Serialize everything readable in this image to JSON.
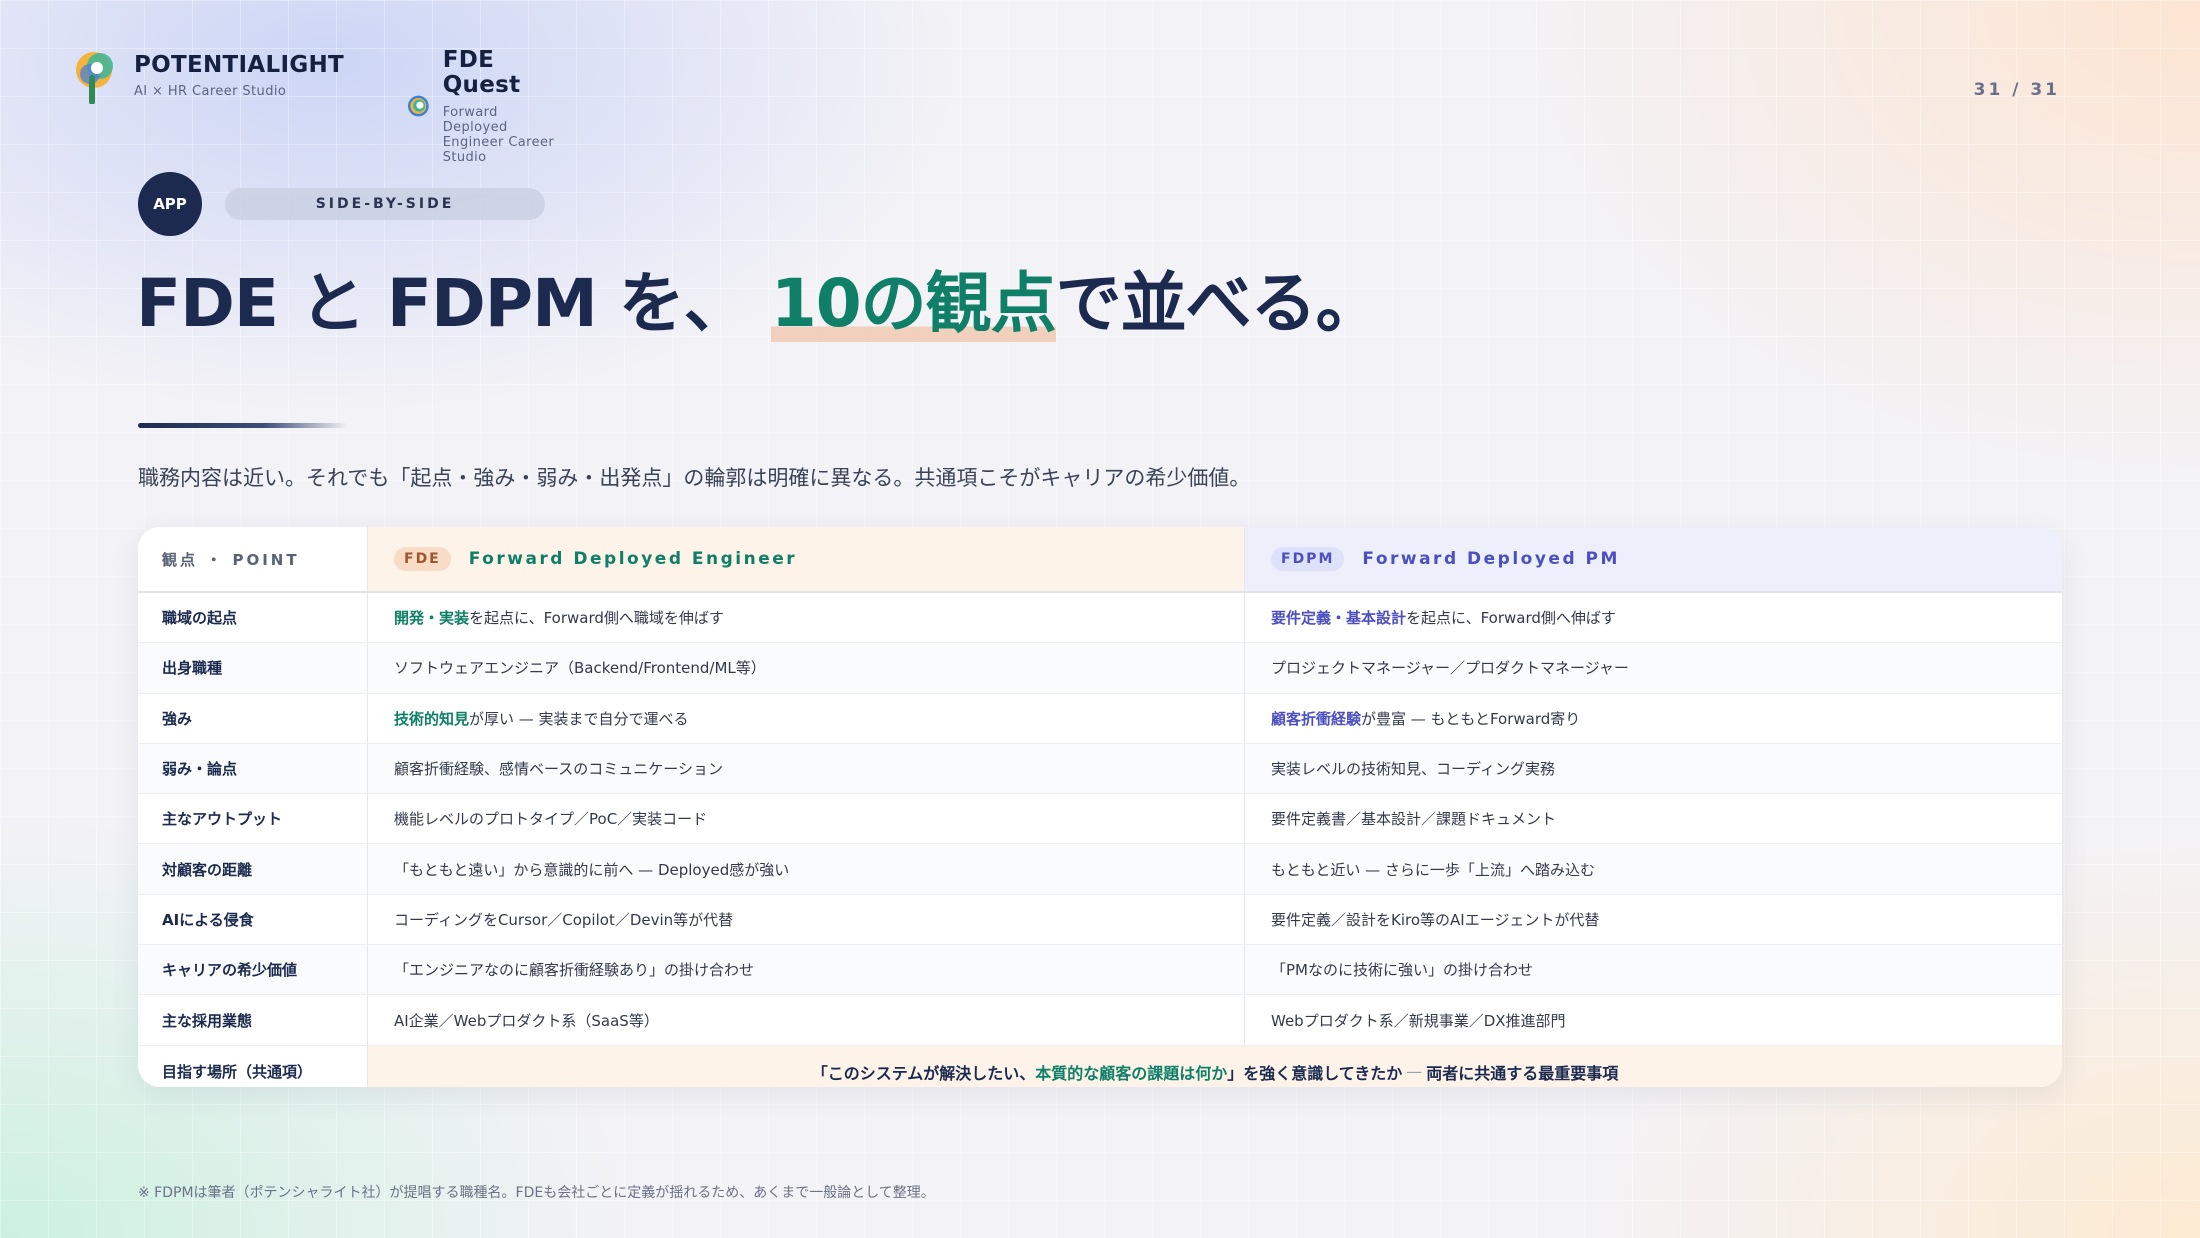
{
  "header": {
    "brand1": {
      "name": "POTENTIALIGHT",
      "tagline": "AI × HR Career Studio"
    },
    "brand2": {
      "name": "FDE Quest",
      "tagline": "Forward Deployed Engineer Career Studio"
    },
    "page_number": "31 / 31"
  },
  "badge": "APP",
  "section_pill": "SIDE-BY-SIDE",
  "title": {
    "part1": "FDE と FDPM を、",
    "highlight": "10の観点",
    "part2": "で並べる。"
  },
  "lead": "職務内容は近い。それでも「起点・強み・弱み・出発点」の輪郭は明確に異なる。共通項こそがキャリアの希少価値。",
  "table": {
    "header_point": "観点 ・ POINT",
    "fde_tag": "FDE",
    "fde_title": "Forward Deployed Engineer",
    "fdpm_tag": "FDPM",
    "fdpm_title": "Forward Deployed PM",
    "rows": [
      {
        "point": "職域の起点",
        "fde_em": "開発・実装",
        "fde": " を起点に、Forward側へ職域を伸ばす",
        "fdpm_em": "要件定義・基本設計",
        "fdpm": " を起点に、Forward側へ伸ばす"
      },
      {
        "point": "出身職種",
        "fde_em": "",
        "fde": "ソフトウェアエンジニア（Backend/Frontend/ML等）",
        "fdpm_em": "",
        "fdpm": "プロジェクトマネージャー／プロダクトマネージャー"
      },
      {
        "point": "強み",
        "fde_em": "技術的知見",
        "fde": "が厚い — 実装まで自分で運べる",
        "fdpm_em": "顧客折衝経験",
        "fdpm": "が豊富 — もともとForward寄り"
      },
      {
        "point": "弱み・論点",
        "fde_em": "",
        "fde": "顧客折衝経験、感情ベースのコミュニケーション",
        "fdpm_em": "",
        "fdpm": "実装レベルの技術知見、コーディング実務"
      },
      {
        "point": "主なアウトプット",
        "fde_em": "",
        "fde": "機能レベルのプロトタイプ／PoC／実装コード",
        "fdpm_em": "",
        "fdpm": "要件定義書／基本設計／課題ドキュメント"
      },
      {
        "point": "対顧客の距離",
        "fde_em": "",
        "fde": "「もともと遠い」から意識的に前へ — Deployed感が強い",
        "fdpm_em": "",
        "fdpm": "もともと近い — さらに一歩「上流」へ踏み込む"
      },
      {
        "point": "AIによる侵食",
        "fde_em": "",
        "fde": "コーディングをCursor／Copilot／Devin等が代替",
        "fdpm_em": "",
        "fdpm": "要件定義／設計をKiro等のAIエージェントが代替"
      },
      {
        "point": "キャリアの希少価値",
        "fde_em": "",
        "fde": "「エンジニアなのに顧客折衝経験あり」の掛け合わせ",
        "fdpm_em": "",
        "fdpm": "「PMなのに技術に強い」の掛け合わせ"
      },
      {
        "point": "主な採用業態",
        "fde_em": "",
        "fde": "AI企業／Webプロダクト系（SaaS等）",
        "fdpm_em": "",
        "fdpm": "Webプロダクト系／新規事業／DX推進部門"
      }
    ],
    "final": {
      "point": "目指す場所（共通項）",
      "pre": "「このシステムが解決したい、",
      "em": "本質的な顧客の課題は何か",
      "post": "」を強く意識してきたか",
      "dash": "—",
      "tail": "両者に共通する最重要事項"
    }
  },
  "footnote": "※ FDPMは筆者（ポテンシャライト社）が提唱する職種名。FDEも会社ごとに定義が揺れるため、あくまで一般論として整理。",
  "colors": {
    "navy": "#1b2a4e",
    "green": "#0f7f68",
    "purple": "#4b4fc0",
    "peach": "#fdf3e9",
    "lavender": "#edf0fb"
  }
}
